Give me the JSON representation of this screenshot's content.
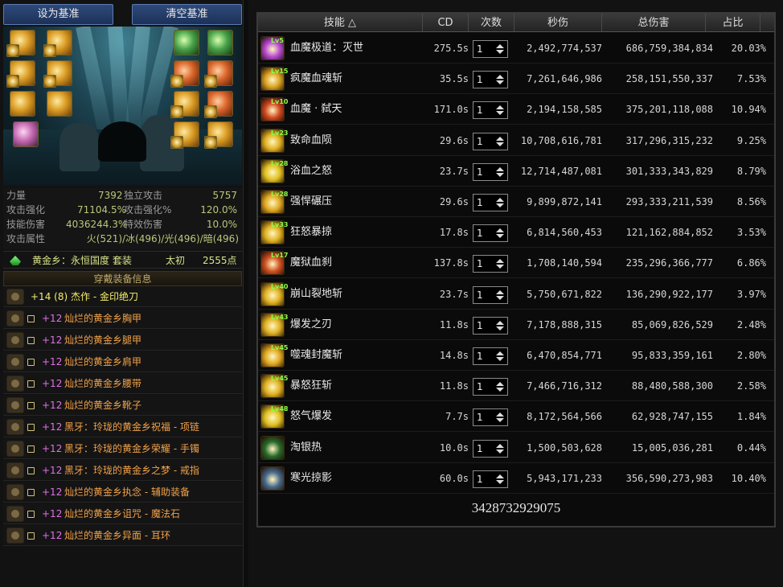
{
  "buttons": {
    "set_baseline": "设为基准",
    "clear_baseline": "清空基准"
  },
  "stats": {
    "rows": [
      {
        "l1": "力量",
        "v1": "7392",
        "l2": "独立攻击",
        "v2": "5757"
      },
      {
        "l1": "攻击强化",
        "v1": "71104.5%",
        "l2": "攻击强化%",
        "v2": "120.0%"
      },
      {
        "l1": "技能伤害",
        "v1": "4036244.3%",
        "l2": "特效伤害",
        "v2": "10.0%"
      },
      {
        "l1": "攻击属性",
        "v1": "火(521)/冰(496)/光(496)/暗(496)"
      }
    ]
  },
  "set": {
    "name": "黄金乡：永恒国度 套装",
    "stage": "太初",
    "points": "2555点"
  },
  "equip_header": "穿戴装备信息",
  "equipment": [
    {
      "level": "+14 (8)",
      "name": "杰作 - 金印绝刀",
      "level_color": "#f5ee6a",
      "name_color": "#f5ee6a"
    },
    {
      "level": "+12",
      "name": "灿烂的黄金乡胸甲",
      "level_color": "#e070e8",
      "name_color": "#f2a24a"
    },
    {
      "level": "+12",
      "name": "灿烂的黄金乡腿甲",
      "level_color": "#e070e8",
      "name_color": "#f2a24a"
    },
    {
      "level": "+12",
      "name": "灿烂的黄金乡肩甲",
      "level_color": "#e070e8",
      "name_color": "#f2a24a"
    },
    {
      "level": "+12",
      "name": "灿烂的黄金乡腰带",
      "level_color": "#e070e8",
      "name_color": "#f2a24a"
    },
    {
      "level": "+12",
      "name": "灿烂的黄金乡靴子",
      "level_color": "#e070e8",
      "name_color": "#f2a24a"
    },
    {
      "level": "+12",
      "name": "黑牙：玲珑的黄金乡祝福 - 项链",
      "level_color": "#e070e8",
      "name_color": "#f2a24a"
    },
    {
      "level": "+12",
      "name": "黑牙：玲珑的黄金乡荣耀 - 手镯",
      "level_color": "#e070e8",
      "name_color": "#f2a24a"
    },
    {
      "level": "+12",
      "name": "黑牙：玲珑的黄金乡之梦 - 戒指",
      "level_color": "#e070e8",
      "name_color": "#f2a24a"
    },
    {
      "level": "+12",
      "name": "灿烂的黄金乡执念 - 辅助装备",
      "level_color": "#e070e8",
      "name_color": "#f2a24a"
    },
    {
      "level": "+12",
      "name": "灿烂的黄金乡诅咒 - 魔法石",
      "level_color": "#e070e8",
      "name_color": "#f2a24a"
    },
    {
      "level": "+12",
      "name": "灿烂的黄金乡异面 - 耳环",
      "level_color": "#e070e8",
      "name_color": "#f2a24a"
    }
  ],
  "table": {
    "headers": [
      "技能 △",
      "CD",
      "次数",
      "秒伤",
      "总伤害",
      "占比"
    ],
    "rows": [
      {
        "lv": "Lv5",
        "name": "血魔极道：灭世",
        "cd": "275.5s",
        "count": "1",
        "dps": "2,492,774,537",
        "total": "686,759,384,834",
        "pct": "20.03%",
        "color": "#b84ad0"
      },
      {
        "lv": "Lv15",
        "name": "疯魔血魂斩",
        "cd": "35.5s",
        "count": "1",
        "dps": "7,261,646,986",
        "total": "258,151,550,337",
        "pct": "7.53%",
        "color": "#d8a020"
      },
      {
        "lv": "Lv10",
        "name": "血魔 · 弑天",
        "cd": "171.0s",
        "count": "1",
        "dps": "2,194,158,585",
        "total": "375,201,118,088",
        "pct": "10.94%",
        "color": "#d04820"
      },
      {
        "lv": "Lv23",
        "name": "致命血陨",
        "cd": "29.6s",
        "count": "1",
        "dps": "10,708,616,781",
        "total": "317,296,315,232",
        "pct": "9.25%",
        "color": "#e0b020"
      },
      {
        "lv": "Lv28",
        "name": "浴血之怒",
        "cd": "23.7s",
        "count": "1",
        "dps": "12,714,487,081",
        "total": "301,333,343,829",
        "pct": "8.79%",
        "color": "#e0c020"
      },
      {
        "lv": "Lv28",
        "name": "强悍碾压",
        "cd": "29.6s",
        "count": "1",
        "dps": "9,899,872,141",
        "total": "293,333,211,539",
        "pct": "8.56%",
        "color": "#e0a820"
      },
      {
        "lv": "Lv33",
        "name": "狂怒暴掠",
        "cd": "17.8s",
        "count": "1",
        "dps": "6,814,560,453",
        "total": "121,162,884,852",
        "pct": "3.53%",
        "color": "#e0b020"
      },
      {
        "lv": "Lv17",
        "name": "魔狱血刹",
        "cd": "137.8s",
        "count": "1",
        "dps": "1,708,140,594",
        "total": "235,296,366,777",
        "pct": "6.86%",
        "color": "#d05020"
      },
      {
        "lv": "Lv40",
        "name": "崩山裂地斩",
        "cd": "23.7s",
        "count": "1",
        "dps": "5,750,671,822",
        "total": "136,290,922,177",
        "pct": "3.97%",
        "color": "#e0b020"
      },
      {
        "lv": "Lv43",
        "name": "爆发之刃",
        "cd": "11.8s",
        "count": "1",
        "dps": "7,178,888,315",
        "total": "85,069,826,529",
        "pct": "2.48%",
        "color": "#e0b020"
      },
      {
        "lv": "Lv45",
        "name": "噬魂封魔斩",
        "cd": "14.8s",
        "count": "1",
        "dps": "6,470,854,771",
        "total": "95,833,359,161",
        "pct": "2.80%",
        "color": "#e0a820"
      },
      {
        "lv": "Lv45",
        "name": "暴怒狂斩",
        "cd": "11.8s",
        "count": "1",
        "dps": "7,466,716,312",
        "total": "88,480,588,300",
        "pct": "2.58%",
        "color": "#e0b020"
      },
      {
        "lv": "Lv48",
        "name": "怒气爆发",
        "cd": "7.7s",
        "count": "1",
        "dps": "8,172,564,566",
        "total": "62,928,747,155",
        "pct": "1.84%",
        "color": "#e0c020"
      },
      {
        "lv": "",
        "name": "淘银热",
        "cd": "10.0s",
        "count": "1",
        "dps": "1,500,503,628",
        "total": "15,005,036,281",
        "pct": "0.44%",
        "color": "#2a6a2a"
      },
      {
        "lv": "",
        "name": "寒光掠影",
        "cd": "60.0s",
        "count": "1",
        "dps": "5,943,171,233",
        "total": "356,590,273,983",
        "pct": "10.40%",
        "color": "#4a6a8a"
      }
    ],
    "grand_total": "3428732929075"
  }
}
